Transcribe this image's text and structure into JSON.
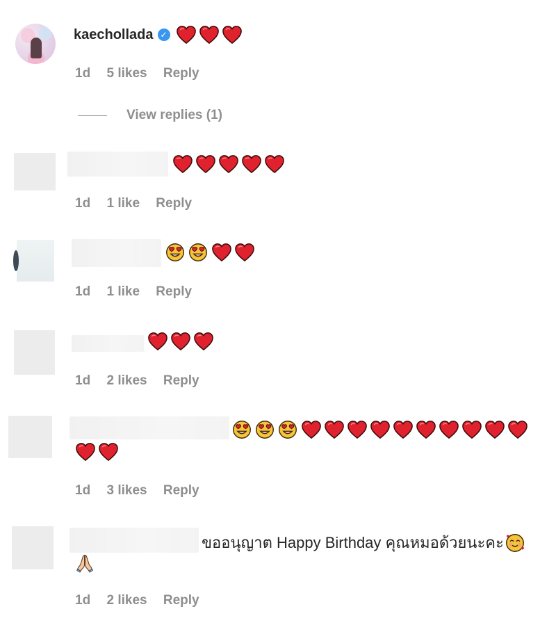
{
  "comments": [
    {
      "username": "kaechollada",
      "verified_icon": "verified-badge-icon",
      "emojis": [
        "heart",
        "heart",
        "heart"
      ],
      "meta": {
        "time": "1d",
        "likes": "5 likes",
        "reply": "Reply"
      },
      "view_replies": "View replies (1)"
    },
    {
      "emojis": [
        "heart",
        "heart",
        "heart",
        "heart",
        "heart"
      ],
      "meta": {
        "time": "1d",
        "likes": "1 like",
        "reply": "Reply"
      }
    },
    {
      "emojis": [
        "heart-eyes",
        "heart-eyes",
        "heart",
        "heart"
      ],
      "meta": {
        "time": "1d",
        "likes": "1 like",
        "reply": "Reply"
      }
    },
    {
      "emojis": [
        "heart",
        "heart",
        "heart"
      ],
      "meta": {
        "time": "1d",
        "likes": "2 likes",
        "reply": "Reply"
      }
    },
    {
      "emojis": [
        "heart-eyes",
        "heart-eyes",
        "heart-eyes",
        "heart",
        "heart",
        "heart",
        "heart",
        "heart",
        "heart",
        "heart",
        "heart",
        "heart",
        "heart"
      ],
      "emojis_line2": [
        "heart",
        "heart"
      ],
      "meta": {
        "time": "1d",
        "likes": "3 likes",
        "reply": "Reply"
      }
    },
    {
      "text": "ขออนุญาต Happy Birthday คุณหมอด้วยนะคะ",
      "trailing_emoji": "smiling-face-with-hearts",
      "line2_emoji": "folded-hands",
      "meta": {
        "time": "1d",
        "likes": "2 likes",
        "reply": "Reply"
      }
    }
  ],
  "colors": {
    "heart": "#e0245e",
    "meta": "#8e8e8e",
    "verified": "#3897f0",
    "face": "#f7c23c"
  }
}
